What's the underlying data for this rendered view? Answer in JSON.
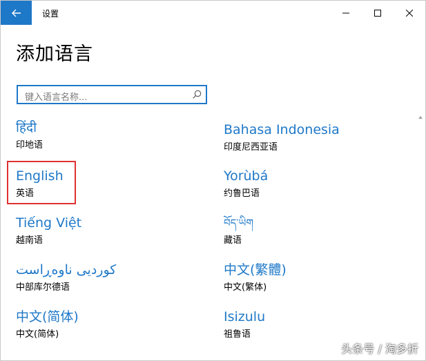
{
  "window": {
    "title": "设置"
  },
  "page": {
    "title": "添加语言"
  },
  "search": {
    "placeholder": "键入语言名称..."
  },
  "languages": [
    {
      "native": "हिंदी",
      "local": "印地语"
    },
    {
      "native": "Bahasa Indonesia",
      "local": "印度尼西亚语"
    },
    {
      "native": "English",
      "local": "英语"
    },
    {
      "native": "Yorùbá",
      "local": "约鲁巴语"
    },
    {
      "native": "Tiếng Việt",
      "local": "越南语"
    },
    {
      "native": "བོད་ཡིག",
      "local": "藏语"
    },
    {
      "native": "کوردیی ناوەڕاست",
      "local": "中部库尔德语"
    },
    {
      "native": "中文(繁體)",
      "local": "中文(繁体)"
    },
    {
      "native": "中文(简体)",
      "local": "中文(简体)"
    },
    {
      "native": "Isizulu",
      "local": "祖鲁语"
    }
  ],
  "watermark": {
    "text": "头条号 / 淘多折"
  },
  "colors": {
    "accent": "#1e78c8",
    "highlight": "#e03030"
  }
}
